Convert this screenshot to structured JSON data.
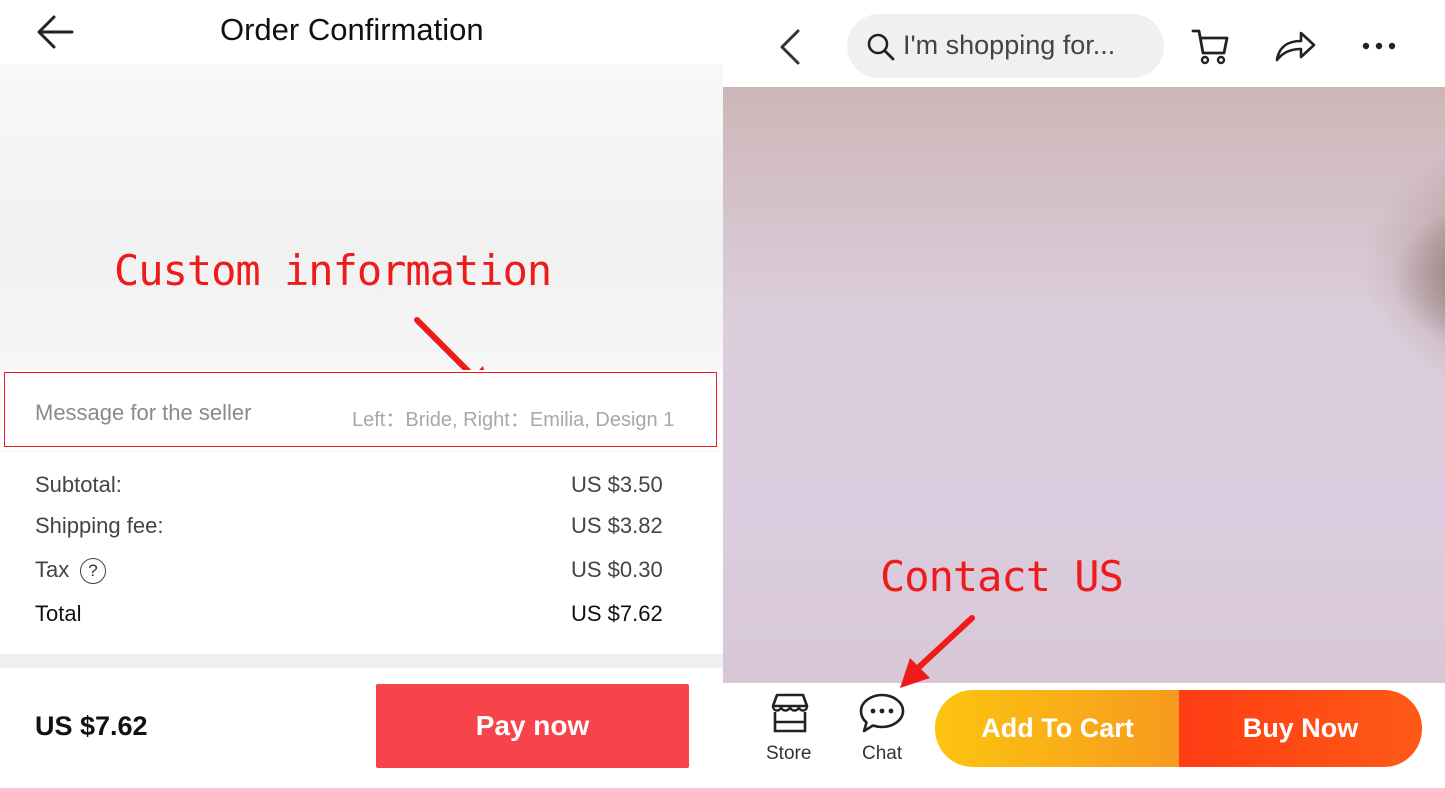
{
  "order": {
    "title": "Order Confirmation",
    "custom_annotation": "Custom information",
    "message": {
      "label": "Message for the seller",
      "value": "Left：Bride, Right：Emilia, Design 1"
    },
    "summary": [
      {
        "label": "Subtotal:",
        "value": "US $3.50"
      },
      {
        "label": "Shipping fee:",
        "value": "US $3.82"
      },
      {
        "label": "Tax",
        "value": "US $0.30"
      },
      {
        "label": "Total",
        "value": "US $7.62"
      }
    ],
    "tax_help_glyph": "?",
    "pay_total": "US $7.62",
    "pay_button": "Pay now"
  },
  "product": {
    "search_placeholder": "I'm shopping for...",
    "contact_annotation": "Contact US",
    "store_label": "Store",
    "chat_label": "Chat",
    "add_to_cart": "Add To Cart",
    "buy_now": "Buy Now"
  },
  "colors": {
    "annotation_red": "#ef1b1b",
    "pay_button": "#f7434a",
    "add_to_cart_start": "#fcc410",
    "buy_now": "#ff3c14"
  }
}
